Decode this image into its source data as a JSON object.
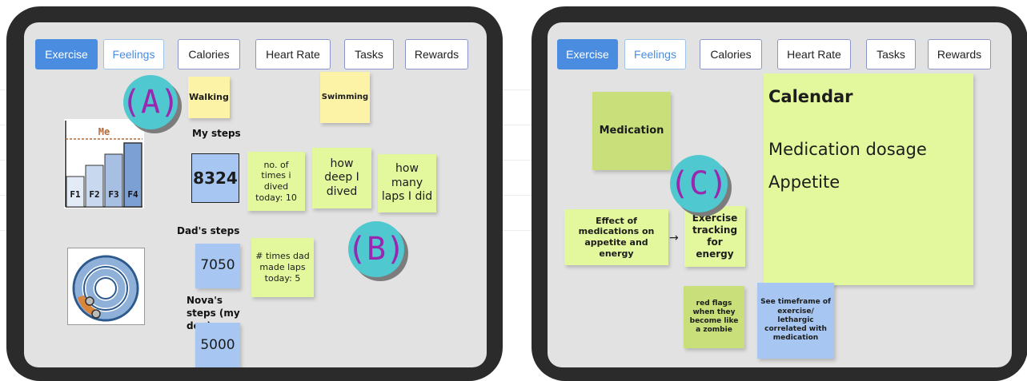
{
  "tabs_left": [
    {
      "label": "Exercise",
      "state": "active"
    },
    {
      "label": "Feelings",
      "state": "soft"
    },
    {
      "label": "Calories",
      "state": "normal"
    },
    {
      "label": "Heart Rate",
      "state": "normal"
    },
    {
      "label": "Tasks",
      "state": "normal"
    },
    {
      "label": "Rewards",
      "state": "normal"
    }
  ],
  "tabs_right": [
    {
      "label": "Exercise",
      "state": "active"
    },
    {
      "label": "Feelings",
      "state": "soft"
    },
    {
      "label": "Calories",
      "state": "normal"
    },
    {
      "label": "Heart Rate",
      "state": "normal"
    },
    {
      "label": "Tasks",
      "state": "normal"
    },
    {
      "label": "Rewards",
      "state": "normal"
    }
  ],
  "left": {
    "badge_a": "(A)",
    "badge_b": "(B)",
    "note_walking": "Walking",
    "note_swimming": "Swimming",
    "label_my_steps": "My steps",
    "my_steps_value": "8324",
    "note_dives": "no. of times i dived today: 10",
    "note_deep": "how deep I dived",
    "note_laps": "how many laps I did",
    "label_dads_steps": "Dad's steps",
    "dads_steps_value": "7050",
    "note_dad_laps": "# times dad made laps today: 5",
    "label_nova_steps": "Nova's steps (my dog)",
    "nova_steps_value": "5000",
    "bar_chart": {
      "marker": "Me",
      "bars": [
        "F1",
        "F2",
        "F3",
        "F4"
      ]
    }
  },
  "right": {
    "badge_c": "(C)",
    "note_medication": "Medication",
    "calendar_title": "Calendar",
    "calendar_line1": "Medication dosage",
    "calendar_line2": "Appetite",
    "note_effect": "Effect of medications on appetite and energy",
    "arrow": "→",
    "note_exercise_tracking": "Exercise tracking for energy",
    "note_red_flags": "red flags when they become like a zombie",
    "note_timeframe": "See timeframe of exercise/ lethargic correlated with medication"
  },
  "colors": {
    "accent": "#4a8de0",
    "badge": "#4fc9cf",
    "badge_text": "#9a27b0",
    "tablet": "#2b2b2b",
    "screen": "#e2e2e2"
  }
}
